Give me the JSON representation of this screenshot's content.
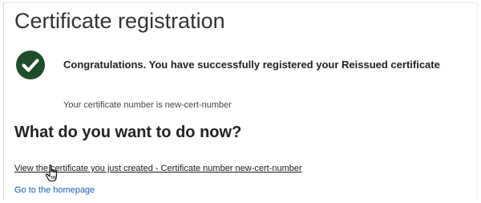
{
  "page": {
    "title": "Certificate registration"
  },
  "success": {
    "icon": "check-circle-icon",
    "icon_color": "#1e4d2b",
    "message": "Congratulations. You have successfully registered your Reissued certificate",
    "certificate_number_text": "Your certificate number is new-cert-number"
  },
  "next_steps": {
    "heading": "What do you want to do now?",
    "view_certificate_link": "View the certificate you just created - Certificate number new-cert-number",
    "homepage_link": "Go to the homepage",
    "link_color": "#1a5fb4"
  },
  "cursor": {
    "icon": "hand-pointer-icon"
  }
}
